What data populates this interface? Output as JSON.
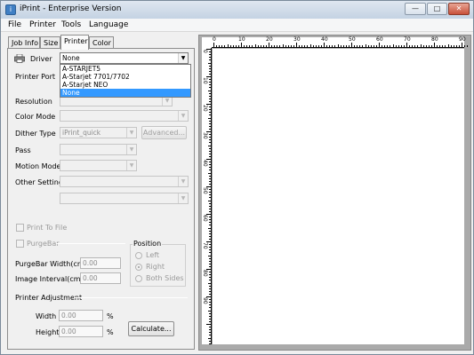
{
  "window": {
    "title": "iPrint - Enterprise Version",
    "minimize_glyph": "—",
    "maximize_glyph": "□",
    "close_glyph": "✕"
  },
  "menu": [
    "File",
    "Printer",
    "Tools",
    "Language"
  ],
  "tabs": [
    "Job Info",
    "Size",
    "Printer",
    "Color"
  ],
  "active_tab": "Printer",
  "printer_tab": {
    "driver_label": "Driver",
    "driver_value": "None",
    "driver_options": [
      "A-STARJET5",
      "A-Starjet 7701/7702",
      "A-Starjet NEO",
      "None"
    ],
    "driver_selected": "None",
    "printer_port_label": "Printer Port",
    "resolution_label": "Resolution",
    "color_mode_label": "Color Mode",
    "dither_type_label": "Dither Type",
    "dither_type_value": "iPrint_quick",
    "advanced_button": "Advanced...",
    "pass_label": "Pass",
    "motion_mode_label": "Motion Mode",
    "other_setting_label": "Other Setting",
    "print_to_file_label": "Print To File",
    "purgebar_label": "PurgeBar",
    "position_group_label": "Position",
    "position_options": [
      "Left",
      "Right",
      "Both Sides"
    ],
    "position_selected": "Right",
    "purgebar_width_label": "PurgeBar Width(cm)",
    "purgebar_width_value": "0.00",
    "image_interval_label": "Image Interval(cm)",
    "image_interval_value": "0.00",
    "printer_adjustment_label": "Printer Adjustment",
    "width_label": "Width",
    "width_value": "0.00",
    "height_label": "Height",
    "height_value": "0.00",
    "percent_symbol": "%",
    "calculate_button": "Calculate..."
  },
  "ruler": {
    "top_labels": [
      "0",
      "10",
      "20",
      "30",
      "40",
      "50",
      "60",
      "70",
      "80",
      "90"
    ],
    "left_labels": [
      "0",
      "10",
      "20",
      "30",
      "40",
      "50",
      "60",
      "70",
      "80",
      "90"
    ]
  }
}
